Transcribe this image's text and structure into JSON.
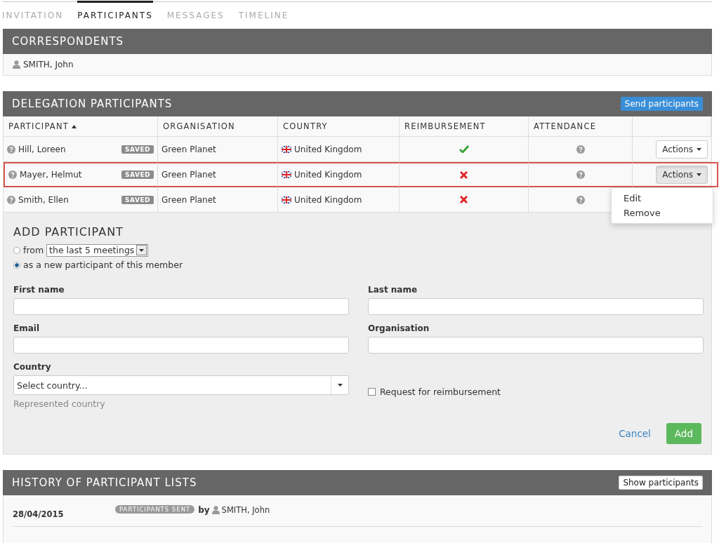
{
  "tabs": [
    {
      "label": "INVITATION",
      "selected": false
    },
    {
      "label": "PARTICIPANTS",
      "selected": true
    },
    {
      "label": "MESSAGES",
      "selected": false
    },
    {
      "label": "TIMELINE",
      "selected": false
    }
  ],
  "correspondents": {
    "title": "CORRESPONDENTS",
    "people": [
      {
        "name": "SMITH, John"
      }
    ]
  },
  "delegation": {
    "title": "DELEGATION PARTICIPANTS",
    "send_button": "Send participants",
    "columns": [
      {
        "label": "PARTICIPANT",
        "sorted": true
      },
      {
        "label": "ORGANISATION",
        "sorted": false
      },
      {
        "label": "COUNTRY",
        "sorted": false
      },
      {
        "label": "REIMBURSEMENT",
        "sorted": false
      },
      {
        "label": "ATTENDANCE",
        "sorted": false
      }
    ],
    "rows": [
      {
        "name": "Hill, Loreen",
        "status": "SAVED",
        "organisation": "Green Planet",
        "country": "United Kingdom",
        "reimbursement": true,
        "actions": "Actions",
        "highlighted": false,
        "menu_open": false
      },
      {
        "name": "Mayer, Helmut",
        "status": "SAVED",
        "organisation": "Green Planet",
        "country": "United Kingdom",
        "reimbursement": false,
        "actions": "Actions",
        "highlighted": true,
        "menu_open": true
      },
      {
        "name": "Smith, Ellen",
        "status": "SAVED",
        "organisation": "Green Planet",
        "country": "United Kingdom",
        "reimbursement": false,
        "highlighted": false
      }
    ],
    "menu": [
      "Edit",
      "Remove"
    ]
  },
  "add_participant": {
    "title": "ADD PARTICIPANT",
    "sources": [
      {
        "label": "from",
        "select": "the last 5 meetings",
        "selected": false
      },
      {
        "label": "as a new participant of this member",
        "selected": true
      }
    ],
    "fields": [
      {
        "label": "First name"
      },
      {
        "label": "Last name"
      },
      {
        "label": "Email"
      },
      {
        "label": "Organisation"
      }
    ],
    "country": {
      "label": "Country",
      "placeholder": "Select country...",
      "help": "Represented country"
    },
    "reimbursement_checkbox": {
      "label": "Request for reimbursement",
      "checked": false
    },
    "cancel": "Cancel",
    "add": "Add"
  },
  "history": {
    "title": "HISTORY OF PARTICIPANT LISTS",
    "button": "Show participants",
    "entries": [
      {
        "date": "28/04/2015",
        "badge": "PARTICIPANTS SENT",
        "by": "by",
        "person": "SMITH, John"
      }
    ]
  }
}
